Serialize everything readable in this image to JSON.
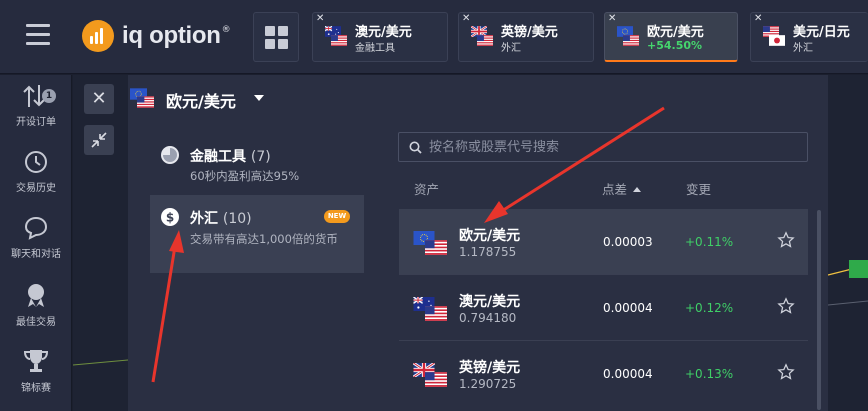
{
  "brand": {
    "name": "iq option",
    "reg": "®"
  },
  "tabs": [
    {
      "name": "澳元/美元",
      "sub": "金融工具",
      "close": "✕"
    },
    {
      "name": "英镑/美元",
      "sub": "外汇",
      "close": "✕"
    },
    {
      "name": "欧元/美元",
      "sub": "+54.50%",
      "close": "✕"
    },
    {
      "name": "美元/日元",
      "sub": "外汇",
      "close": "✕"
    }
  ],
  "nav": [
    {
      "label": "开设订单",
      "badge": "1"
    },
    {
      "label": "交易历史"
    },
    {
      "label": "聊天和对话"
    },
    {
      "label": "最佳交易"
    },
    {
      "label": "锦标赛"
    }
  ],
  "panel": {
    "close": "✕",
    "title": "欧元/美元",
    "categories": [
      {
        "name": "金融工具",
        "count": "(7)",
        "desc": "60秒内盈利高达95%"
      },
      {
        "name": "外汇",
        "count": "(10)",
        "desc": "交易带有高达1,000倍的货币",
        "badge": "NEW"
      }
    ],
    "search_placeholder": "按名称或股票代号搜索",
    "columns": {
      "asset": "资产",
      "spread": "点差",
      "change": "变更"
    },
    "rows": [
      {
        "name": "欧元/美元",
        "price": "1.178755",
        "spread": "0.00003",
        "change": "+0.11%"
      },
      {
        "name": "澳元/美元",
        "price": "0.794180",
        "spread": "0.00004",
        "change": "+0.12%"
      },
      {
        "name": "英镑/美元",
        "price": "1.290725",
        "spread": "0.00004",
        "change": "+0.13%"
      }
    ]
  },
  "colors": {
    "accent": "#f39a1d",
    "positive": "#3fcf67",
    "annotation": "#e8352c"
  }
}
